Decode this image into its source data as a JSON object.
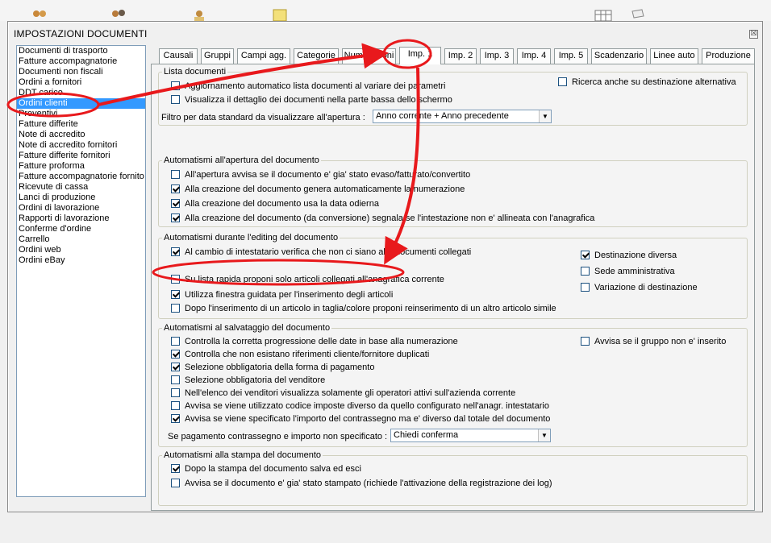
{
  "dialog": {
    "title": "IMPOSTAZIONI DOCUMENTI",
    "close_glyph": "☒"
  },
  "doc_list": {
    "items": [
      "Documenti di trasporto",
      "Fatture accompagnatorie",
      "Documenti non fiscali",
      "Ordini a fornitori",
      "DDT carico",
      "Ordini clienti",
      "Preventivi",
      "Fatture differite",
      "Note di accredito",
      "Note di accredito fornitori",
      "Fatture differite fornitori",
      "Fatture proforma",
      "Fatture accompagnatorie fornito",
      "Ricevute di cassa",
      "Lanci di produzione",
      "Ordini di lavorazione",
      "Rapporti di lavorazione",
      "Conferme d'ordine",
      "Carrello",
      "Ordini web",
      "Ordini eBay"
    ],
    "selected": "Ordini clienti"
  },
  "tabs": [
    "Causali",
    "Gruppi",
    "Campi agg.",
    "Categorie",
    "Numerazioni",
    "Imp. 1",
    "Imp. 2",
    "Imp. 3",
    "Imp. 4",
    "Imp. 5",
    "Scadenzario",
    "Linee auto",
    "Produzione"
  ],
  "active_tab": "Imp. 1",
  "groups": {
    "lista": {
      "legend": "Lista documenti",
      "opt1": "Aggiornamento automatico lista documenti al variare dei parametri",
      "opt2": "Visualizza il dettaglio dei documenti nella parte bassa dello schermo",
      "opt3": "Ricerca anche su destinazione alternativa",
      "filter_label": "Filtro per data standard da visualizzare all'apertura :",
      "filter_value": "Anno corrente + Anno precedente"
    },
    "apertura": {
      "legend": "Automatismi all'apertura del documento",
      "opt1": "All'apertura avvisa se il documento e' gia' stato evaso/fatturato/convertito",
      "opt2": "Alla creazione del documento genera automaticamente la numerazione",
      "opt3": "Alla creazione del documento usa la data odierna",
      "opt4": "Alla creazione del documento (da conversione) segnala se l'intestazione non e' allineata con l'anagrafica"
    },
    "editing": {
      "legend": "Automatismi durante l'editing del documento",
      "opt1": "Al cambio di intestatario verifica che non ci siano altri documenti collegati",
      "opt2": "Su lista rapida proponi solo articoli collegati all'anagrafica corrente",
      "opt3": "Utilizza finestra guidata per l'inserimento degli articoli",
      "opt4": "Dopo l'inserimento di un articolo in taglia/colore proponi reinserimento di un altro articolo simile",
      "side1": "Destinazione diversa",
      "side2": "Sede amministrativa",
      "side3": "Variazione di destinazione"
    },
    "salvataggio": {
      "legend": "Automatismi al salvataggio del documento",
      "opt1": "Controlla la corretta progressione delle date in base alla numerazione",
      "opt2": "Controlla che non esistano riferimenti cliente/fornitore duplicati",
      "opt3": "Selezione obbligatoria della forma di pagamento",
      "opt4": "Selezione obbligatoria del venditore",
      "opt5": "Nell'elenco dei venditori visualizza solamente gli operatori attivi sull'azienda corrente",
      "opt6": "Avvisa se viene utilizzato codice imposte diverso da quello configurato nell'anagr. intestatario",
      "opt7": "Avvisa se viene specificato l'importo del contrassegno ma e' diverso dal totale del documento",
      "side1": "Avvisa se il gruppo non e' inserito",
      "contr_label": "Se pagamento contrassegno e importo non specificato :",
      "contr_value": "Chiedi conferma"
    },
    "stampa": {
      "legend": "Automatismi alla stampa del documento",
      "opt1": "Dopo la stampa del documento salva ed esci",
      "opt2": "Avvisa se il documento e' gia' stato stampato (richiede l'attivazione della registrazione dei log)"
    }
  },
  "combo_arrow": "▼",
  "colors": {
    "selection": "#3399ff",
    "annotation": "#e8191c",
    "check_green": "#21a121"
  }
}
